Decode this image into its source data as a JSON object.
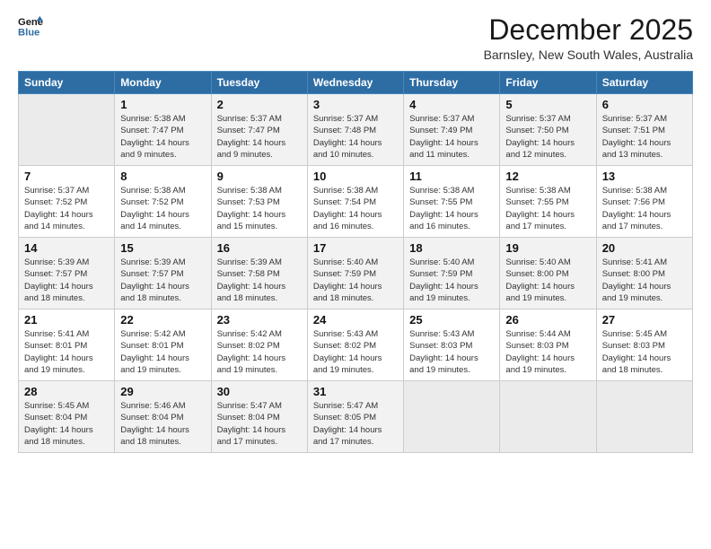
{
  "logo": {
    "line1": "General",
    "line2": "Blue"
  },
  "title": "December 2025",
  "subtitle": "Barnsley, New South Wales, Australia",
  "days": [
    "Sunday",
    "Monday",
    "Tuesday",
    "Wednesday",
    "Thursday",
    "Friday",
    "Saturday"
  ],
  "weeks": [
    [
      {
        "num": "",
        "sunrise": "",
        "sunset": "",
        "daylight": ""
      },
      {
        "num": "1",
        "sunrise": "Sunrise: 5:38 AM",
        "sunset": "Sunset: 7:47 PM",
        "daylight": "Daylight: 14 hours and 9 minutes."
      },
      {
        "num": "2",
        "sunrise": "Sunrise: 5:37 AM",
        "sunset": "Sunset: 7:47 PM",
        "daylight": "Daylight: 14 hours and 9 minutes."
      },
      {
        "num": "3",
        "sunrise": "Sunrise: 5:37 AM",
        "sunset": "Sunset: 7:48 PM",
        "daylight": "Daylight: 14 hours and 10 minutes."
      },
      {
        "num": "4",
        "sunrise": "Sunrise: 5:37 AM",
        "sunset": "Sunset: 7:49 PM",
        "daylight": "Daylight: 14 hours and 11 minutes."
      },
      {
        "num": "5",
        "sunrise": "Sunrise: 5:37 AM",
        "sunset": "Sunset: 7:50 PM",
        "daylight": "Daylight: 14 hours and 12 minutes."
      },
      {
        "num": "6",
        "sunrise": "Sunrise: 5:37 AM",
        "sunset": "Sunset: 7:51 PM",
        "daylight": "Daylight: 14 hours and 13 minutes."
      }
    ],
    [
      {
        "num": "7",
        "sunrise": "Sunrise: 5:37 AM",
        "sunset": "Sunset: 7:52 PM",
        "daylight": "Daylight: 14 hours and 14 minutes."
      },
      {
        "num": "8",
        "sunrise": "Sunrise: 5:38 AM",
        "sunset": "Sunset: 7:52 PM",
        "daylight": "Daylight: 14 hours and 14 minutes."
      },
      {
        "num": "9",
        "sunrise": "Sunrise: 5:38 AM",
        "sunset": "Sunset: 7:53 PM",
        "daylight": "Daylight: 14 hours and 15 minutes."
      },
      {
        "num": "10",
        "sunrise": "Sunrise: 5:38 AM",
        "sunset": "Sunset: 7:54 PM",
        "daylight": "Daylight: 14 hours and 16 minutes."
      },
      {
        "num": "11",
        "sunrise": "Sunrise: 5:38 AM",
        "sunset": "Sunset: 7:55 PM",
        "daylight": "Daylight: 14 hours and 16 minutes."
      },
      {
        "num": "12",
        "sunrise": "Sunrise: 5:38 AM",
        "sunset": "Sunset: 7:55 PM",
        "daylight": "Daylight: 14 hours and 17 minutes."
      },
      {
        "num": "13",
        "sunrise": "Sunrise: 5:38 AM",
        "sunset": "Sunset: 7:56 PM",
        "daylight": "Daylight: 14 hours and 17 minutes."
      }
    ],
    [
      {
        "num": "14",
        "sunrise": "Sunrise: 5:39 AM",
        "sunset": "Sunset: 7:57 PM",
        "daylight": "Daylight: 14 hours and 18 minutes."
      },
      {
        "num": "15",
        "sunrise": "Sunrise: 5:39 AM",
        "sunset": "Sunset: 7:57 PM",
        "daylight": "Daylight: 14 hours and 18 minutes."
      },
      {
        "num": "16",
        "sunrise": "Sunrise: 5:39 AM",
        "sunset": "Sunset: 7:58 PM",
        "daylight": "Daylight: 14 hours and 18 minutes."
      },
      {
        "num": "17",
        "sunrise": "Sunrise: 5:40 AM",
        "sunset": "Sunset: 7:59 PM",
        "daylight": "Daylight: 14 hours and 18 minutes."
      },
      {
        "num": "18",
        "sunrise": "Sunrise: 5:40 AM",
        "sunset": "Sunset: 7:59 PM",
        "daylight": "Daylight: 14 hours and 19 minutes."
      },
      {
        "num": "19",
        "sunrise": "Sunrise: 5:40 AM",
        "sunset": "Sunset: 8:00 PM",
        "daylight": "Daylight: 14 hours and 19 minutes."
      },
      {
        "num": "20",
        "sunrise": "Sunrise: 5:41 AM",
        "sunset": "Sunset: 8:00 PM",
        "daylight": "Daylight: 14 hours and 19 minutes."
      }
    ],
    [
      {
        "num": "21",
        "sunrise": "Sunrise: 5:41 AM",
        "sunset": "Sunset: 8:01 PM",
        "daylight": "Daylight: 14 hours and 19 minutes."
      },
      {
        "num": "22",
        "sunrise": "Sunrise: 5:42 AM",
        "sunset": "Sunset: 8:01 PM",
        "daylight": "Daylight: 14 hours and 19 minutes."
      },
      {
        "num": "23",
        "sunrise": "Sunrise: 5:42 AM",
        "sunset": "Sunset: 8:02 PM",
        "daylight": "Daylight: 14 hours and 19 minutes."
      },
      {
        "num": "24",
        "sunrise": "Sunrise: 5:43 AM",
        "sunset": "Sunset: 8:02 PM",
        "daylight": "Daylight: 14 hours and 19 minutes."
      },
      {
        "num": "25",
        "sunrise": "Sunrise: 5:43 AM",
        "sunset": "Sunset: 8:03 PM",
        "daylight": "Daylight: 14 hours and 19 minutes."
      },
      {
        "num": "26",
        "sunrise": "Sunrise: 5:44 AM",
        "sunset": "Sunset: 8:03 PM",
        "daylight": "Daylight: 14 hours and 19 minutes."
      },
      {
        "num": "27",
        "sunrise": "Sunrise: 5:45 AM",
        "sunset": "Sunset: 8:03 PM",
        "daylight": "Daylight: 14 hours and 18 minutes."
      }
    ],
    [
      {
        "num": "28",
        "sunrise": "Sunrise: 5:45 AM",
        "sunset": "Sunset: 8:04 PM",
        "daylight": "Daylight: 14 hours and 18 minutes."
      },
      {
        "num": "29",
        "sunrise": "Sunrise: 5:46 AM",
        "sunset": "Sunset: 8:04 PM",
        "daylight": "Daylight: 14 hours and 18 minutes."
      },
      {
        "num": "30",
        "sunrise": "Sunrise: 5:47 AM",
        "sunset": "Sunset: 8:04 PM",
        "daylight": "Daylight: 14 hours and 17 minutes."
      },
      {
        "num": "31",
        "sunrise": "Sunrise: 5:47 AM",
        "sunset": "Sunset: 8:05 PM",
        "daylight": "Daylight: 14 hours and 17 minutes."
      },
      {
        "num": "",
        "sunrise": "",
        "sunset": "",
        "daylight": ""
      },
      {
        "num": "",
        "sunrise": "",
        "sunset": "",
        "daylight": ""
      },
      {
        "num": "",
        "sunrise": "",
        "sunset": "",
        "daylight": ""
      }
    ]
  ]
}
